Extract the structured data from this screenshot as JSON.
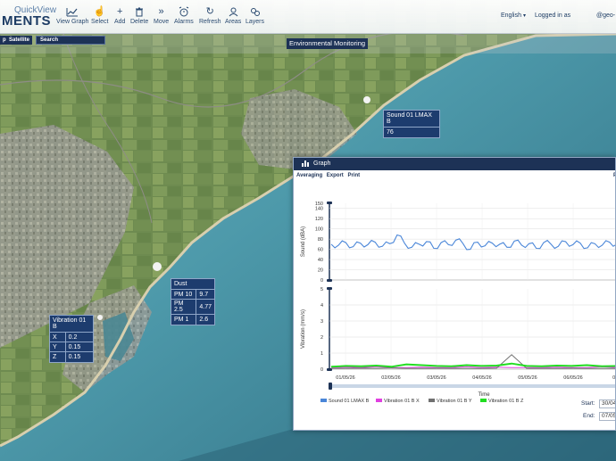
{
  "app": {
    "brand_top": "QuickView",
    "brand_main": "MENTS"
  },
  "toolbar": [
    {
      "id": "view-graph",
      "label": "View Graph",
      "icon": "chart-icon"
    },
    {
      "id": "select",
      "label": "Select",
      "icon": "hand-pointer-icon"
    },
    {
      "id": "add",
      "label": "Add",
      "icon": "plus-icon"
    },
    {
      "id": "delete",
      "label": "Delete",
      "icon": "trash-icon"
    },
    {
      "id": "move",
      "label": "Move",
      "icon": "double-chevron-icon"
    },
    {
      "id": "alarms",
      "label": "Alarms",
      "icon": "alarm-clock-icon"
    },
    {
      "id": "refresh",
      "label": "Refresh",
      "icon": "refresh-icon"
    },
    {
      "id": "areas",
      "label": "Areas",
      "icon": "user-icon"
    },
    {
      "id": "layers",
      "label": "Layers",
      "icon": "layers-icon"
    }
  ],
  "header": {
    "language": "English",
    "logged_in": "Logged in as",
    "user": "@geo-"
  },
  "map": {
    "type_map": "p",
    "type_satellite": "Satellite",
    "search_placeholder": "Search",
    "title": "Environmental Monitoring"
  },
  "popups": {
    "sound": {
      "title": "Sound 01 LMAX B",
      "value": "76"
    },
    "dust": {
      "title": "Dust",
      "rows": [
        {
          "key": "PM 10",
          "value": "9.7"
        },
        {
          "key": "PM 2.5",
          "value": "4.77"
        },
        {
          "key": "PM 1",
          "value": "2.6"
        }
      ]
    },
    "vibration": {
      "title": "Vibration 01 B",
      "rows": [
        {
          "key": "X",
          "value": "0.2"
        },
        {
          "key": "Y",
          "value": "0.15"
        },
        {
          "key": "Z",
          "value": "0.15"
        }
      ]
    }
  },
  "graph": {
    "title": "Graph",
    "menu": [
      "Averaging",
      "Export",
      "Print"
    ],
    "menu_right": "P",
    "start_label": "Start:",
    "start_value": "30/04",
    "end_label": "End:",
    "end_value": "07/05"
  },
  "colors": {
    "sound": "#4a86d8",
    "vib_x": "#e040e0",
    "vib_y": "#707070",
    "vib_z": "#22dd22",
    "panel": "#1d3256"
  },
  "chart_data": [
    {
      "type": "line",
      "ylabel": "Sound (dBA)",
      "ylim": [
        0,
        150
      ],
      "yticks": [
        "0",
        "20",
        "40",
        "60",
        "80",
        "100",
        "120",
        "140",
        "150"
      ],
      "x": [
        "01/05/26",
        "02/05/26",
        "03/05/26",
        "04/05/26",
        "05/05/26",
        "06/05/26",
        "07/05"
      ],
      "series": [
        {
          "name": "Sound 01 LMAX B",
          "values": [
            70,
            68,
            73,
            65,
            72,
            69,
            74,
            66,
            71,
            88,
            72,
            64,
            70,
            75,
            62,
            73,
            69,
            78,
            71,
            60,
            74,
            67,
            72,
            70,
            64,
            76,
            68,
            71,
            62,
            73,
            70,
            66,
            75,
            69,
            72,
            63,
            71,
            68,
            74,
            70
          ]
        }
      ]
    },
    {
      "type": "line",
      "ylabel": "Vibration (mm/s)",
      "ylim": [
        0,
        5
      ],
      "yticks": [
        "0",
        "1",
        "2",
        "3",
        "4",
        "5"
      ],
      "xlabel": "Time",
      "x": [
        "01/05/26",
        "02/05/26",
        "03/05/26",
        "04/05/26",
        "05/05/26",
        "06/05/26",
        "07/05"
      ],
      "series": [
        {
          "name": "Vibration 01 B X",
          "values": [
            0.1,
            0.12,
            0.1,
            0.15,
            0.1,
            0.1,
            0.12,
            0.1,
            0.1,
            0.15,
            0.1,
            0.12,
            0.1,
            0.1,
            0.1,
            0.12,
            0.1,
            0.1,
            0.15,
            0.1
          ]
        },
        {
          "name": "Vibration 01 B Y",
          "values": [
            0.05,
            0.05,
            0.06,
            0.05,
            0.08,
            0.05,
            0.05,
            0.06,
            0.05,
            0.05,
            0.05,
            0.06,
            0.9,
            0.05,
            0.05,
            0.05,
            0.06,
            0.05,
            0.05,
            0.05
          ]
        },
        {
          "name": "Vibration 01 B Z",
          "values": [
            0.15,
            0.2,
            0.18,
            0.22,
            0.15,
            0.3,
            0.25,
            0.2,
            0.18,
            0.25,
            0.2,
            0.22,
            0.35,
            0.2,
            0.18,
            0.22,
            0.2,
            0.25,
            0.18,
            0.2
          ]
        }
      ]
    }
  ]
}
